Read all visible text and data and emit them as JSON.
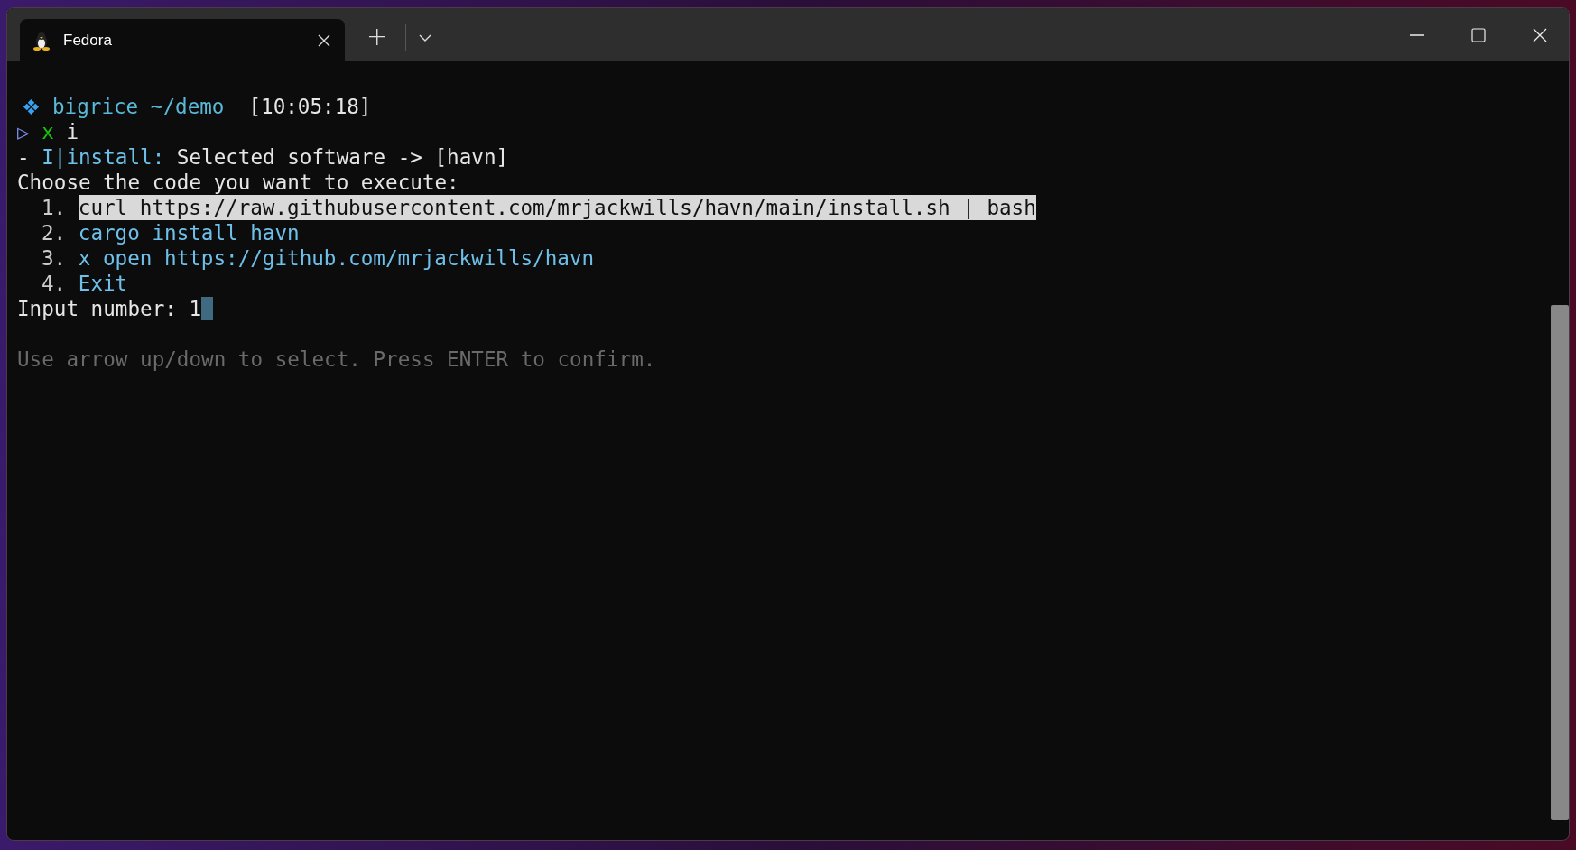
{
  "tabs": [
    {
      "title": "Fedora",
      "selected": true
    }
  ],
  "new_tab_button": "+",
  "prompt": {
    "user_path": "bigrice ~/demo",
    "time": "[10:05:18]"
  },
  "command": {
    "marker": "▷",
    "program": "x",
    "args": "i"
  },
  "status": {
    "dash": "-",
    "tag": "I|install:",
    "message": "Selected software -> [havn]"
  },
  "heading": "Choose the code you want to execute:",
  "options": [
    {
      "number": "1.",
      "text": "curl https://raw.githubusercontent.com/mrjackwills/havn/main/install.sh | bash",
      "selected": true
    },
    {
      "number": "2.",
      "text": "cargo install havn",
      "selected": false
    },
    {
      "number": "3.",
      "text": "x open https://github.com/mrjackwills/havn",
      "selected": false
    },
    {
      "number": "4.",
      "text": "Exit",
      "selected": false
    }
  ],
  "input": {
    "label": "Input number:",
    "value": "1"
  },
  "hint": "Use arrow up/down to select. Press ENTER to confirm."
}
